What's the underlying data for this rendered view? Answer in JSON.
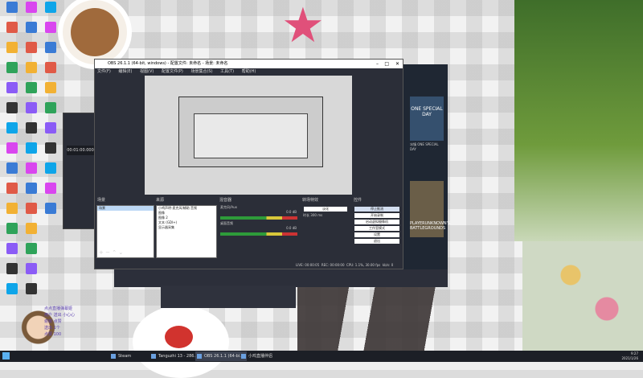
{
  "obs_window": {
    "title": "OBS 26.1.1 (64-bit, windows) - 配置文件: 未命名 - 场景: 未命名",
    "menu": [
      "文件(F)",
      "编辑(E)",
      "视图(V)",
      "配置文件(P)",
      "场景集合(S)",
      "工具(T)",
      "帮助(H)"
    ],
    "docks": {
      "scenes_title": "场景",
      "sources_title": "来源",
      "mixer_title": "混音器",
      "transitions_title": "转场特效",
      "controls_title": "控件"
    },
    "scenes": [
      "场景"
    ],
    "sources": [
      "小鸡声明-麦克风/辅助 音频",
      "图像",
      "图像 2",
      "文本 (GDI+)",
      "显示器采集"
    ],
    "mixer": [
      {
        "name": "麦克风/Aux",
        "level_db": "0.0 dB"
      },
      {
        "name": "桌面音频",
        "level_db": "0.0 dB"
      }
    ],
    "transition": {
      "type": "淡化",
      "duration_label": "时长",
      "duration": "300 ms"
    },
    "controls": [
      "停止推流",
      "开始录制",
      "启动虚拟摄像机",
      "工作室模式",
      "设置",
      "退出"
    ],
    "status": {
      "live": "LIVE: 00:00:05",
      "rec": "REC: 00:00:00",
      "cpu": "CPU: 1.1%, 30.00 fps",
      "kbps": "kb/s: 0"
    }
  },
  "store_panel": {
    "tile_text": "ONE SPECIAL DAY",
    "tile_sub": "冰镇 ONE SPECIAL DAY",
    "game": "PLAYERUNKNOWN'S BATTLEGROUNDS"
  },
  "obs_sidebar": {
    "time": "00:01:00.000"
  },
  "chat_lines": [
    "点点直播弹幕姬",
    "用户 送出 小心心",
    "谢谢 点赞",
    "送出 1个",
    "点赞 100"
  ],
  "taskbar": {
    "items": [
      "Steam",
      "Tanguzhi 13 - 286...",
      "OBS 26.1.1 (64-bi...",
      "小鸡直播伴侣"
    ],
    "active_index": 2,
    "time": "9:27",
    "date": "2021/1/26"
  },
  "colors": {
    "obs_bg": "#2b2e38",
    "taskbar": "#1c1f26",
    "accent": "#6aa0e0"
  }
}
